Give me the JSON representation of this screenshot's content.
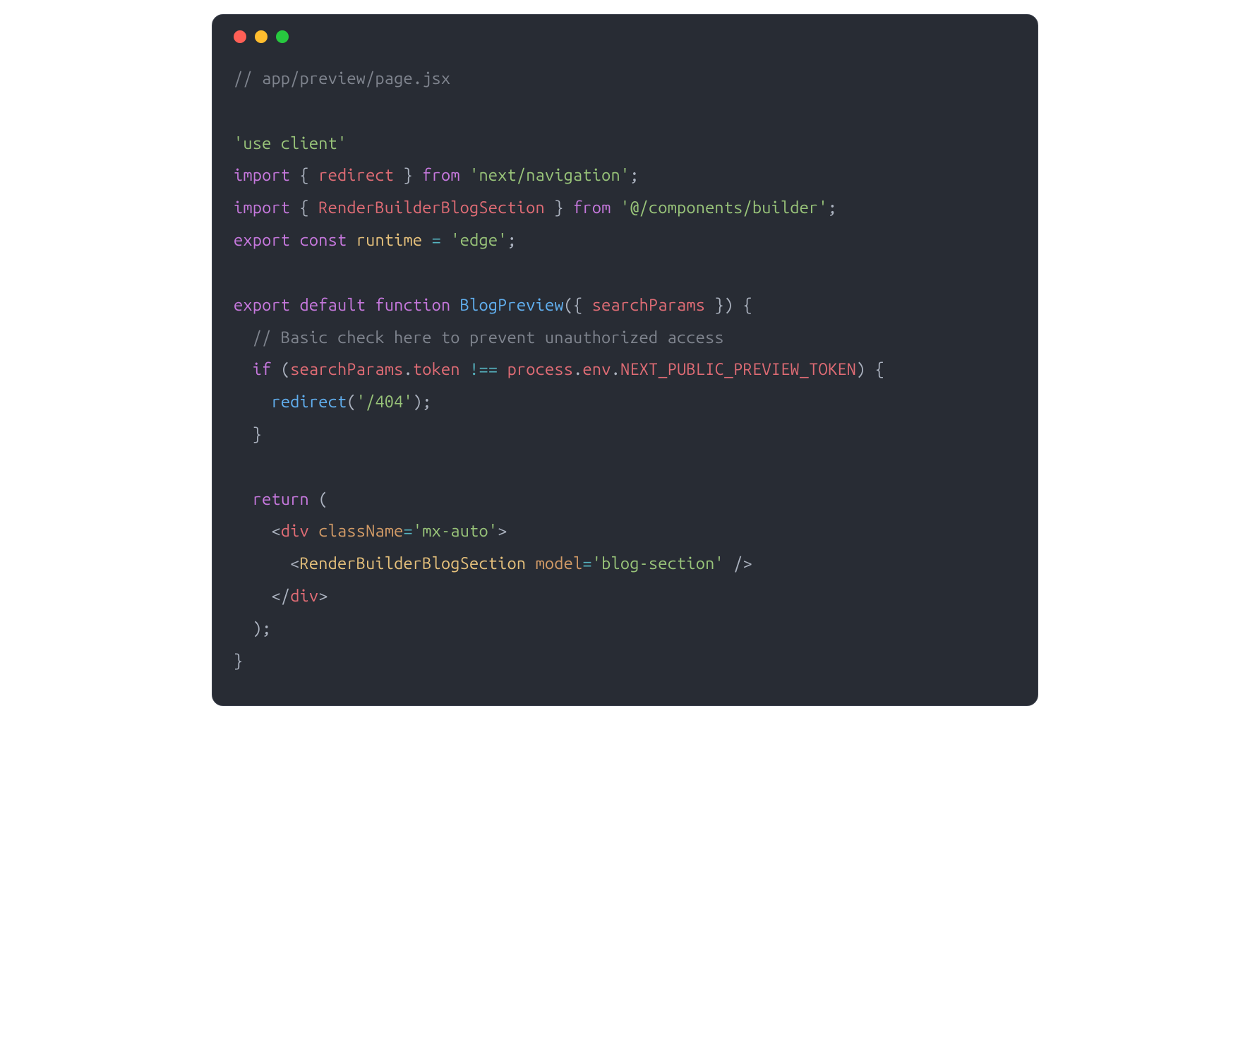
{
  "titlebar": {
    "buttons": [
      "close",
      "minimize",
      "zoom"
    ]
  },
  "code": {
    "line01": {
      "comment": "// app/preview/page.jsx"
    },
    "line02": {
      "blank": ""
    },
    "line03": {
      "string": "'use client'"
    },
    "line04": {
      "kw_import": "import",
      "brace_o": " { ",
      "ident": "redirect",
      "brace_c": " } ",
      "kw_from": "from",
      "sp": " ",
      "str": "'next/navigation'",
      "semi": ";"
    },
    "line05": {
      "kw_import": "import",
      "brace_o": " { ",
      "ident": "RenderBuilderBlogSection",
      "brace_c": " } ",
      "kw_from": "from",
      "sp": " ",
      "str": "'@/components/builder'",
      "semi": ";"
    },
    "line06": {
      "kw_export": "export",
      "sp1": " ",
      "kw_const": "const",
      "sp2": " ",
      "ident": "runtime",
      "sp3": " ",
      "op": "=",
      "sp4": " ",
      "str": "'edge'",
      "semi": ";"
    },
    "line07": {
      "blank": ""
    },
    "line08": {
      "kw_export": "export",
      "sp1": " ",
      "kw_default": "default",
      "sp2": " ",
      "kw_function": "function",
      "sp3": " ",
      "fn": "BlogPreview",
      "po": "(",
      "bo": "{ ",
      "param": "searchParams",
      "bc": " }",
      "pc": ")",
      "sp4": " ",
      "cbo": "{"
    },
    "line09": {
      "indent": "  ",
      "comment": "// Basic check here to prevent unauthorized access"
    },
    "line10": {
      "indent": "  ",
      "kw_if": "if",
      "sp1": " ",
      "po": "(",
      "obj1": "searchParams",
      "dot1": ".",
      "prop1": "token",
      "sp2": " ",
      "op": "!==",
      "sp3": " ",
      "obj2": "process",
      "dot2": ".",
      "prop2": "env",
      "dot3": ".",
      "prop3": "NEXT_PUBLIC_PREVIEW_TOKEN",
      "pc": ")",
      "sp4": " ",
      "cbo": "{"
    },
    "line11": {
      "indent": "    ",
      "fn": "redirect",
      "po": "(",
      "str": "'/404'",
      "pc": ")",
      "semi": ";"
    },
    "line12": {
      "indent": "  ",
      "cbc": "}"
    },
    "line13": {
      "blank": ""
    },
    "line14": {
      "indent": "  ",
      "kw_return": "return",
      "sp": " ",
      "po": "("
    },
    "line15": {
      "indent": "    ",
      "lt": "<",
      "tag": "div",
      "sp": " ",
      "attr": "className",
      "eq": "=",
      "str": "'mx-auto'",
      "gt": ">"
    },
    "line16": {
      "indent": "      ",
      "lt": "<",
      "comp": "RenderBuilderBlogSection",
      "sp": " ",
      "attr": "model",
      "eq": "=",
      "str": "'blog-section'",
      "sp2": " ",
      "close": "/>"
    },
    "line17": {
      "indent": "    ",
      "lt": "</",
      "tag": "div",
      "gt": ">"
    },
    "line18": {
      "indent": "  ",
      "pc": ")",
      "semi": ";"
    },
    "line19": {
      "cbc": "}"
    }
  }
}
